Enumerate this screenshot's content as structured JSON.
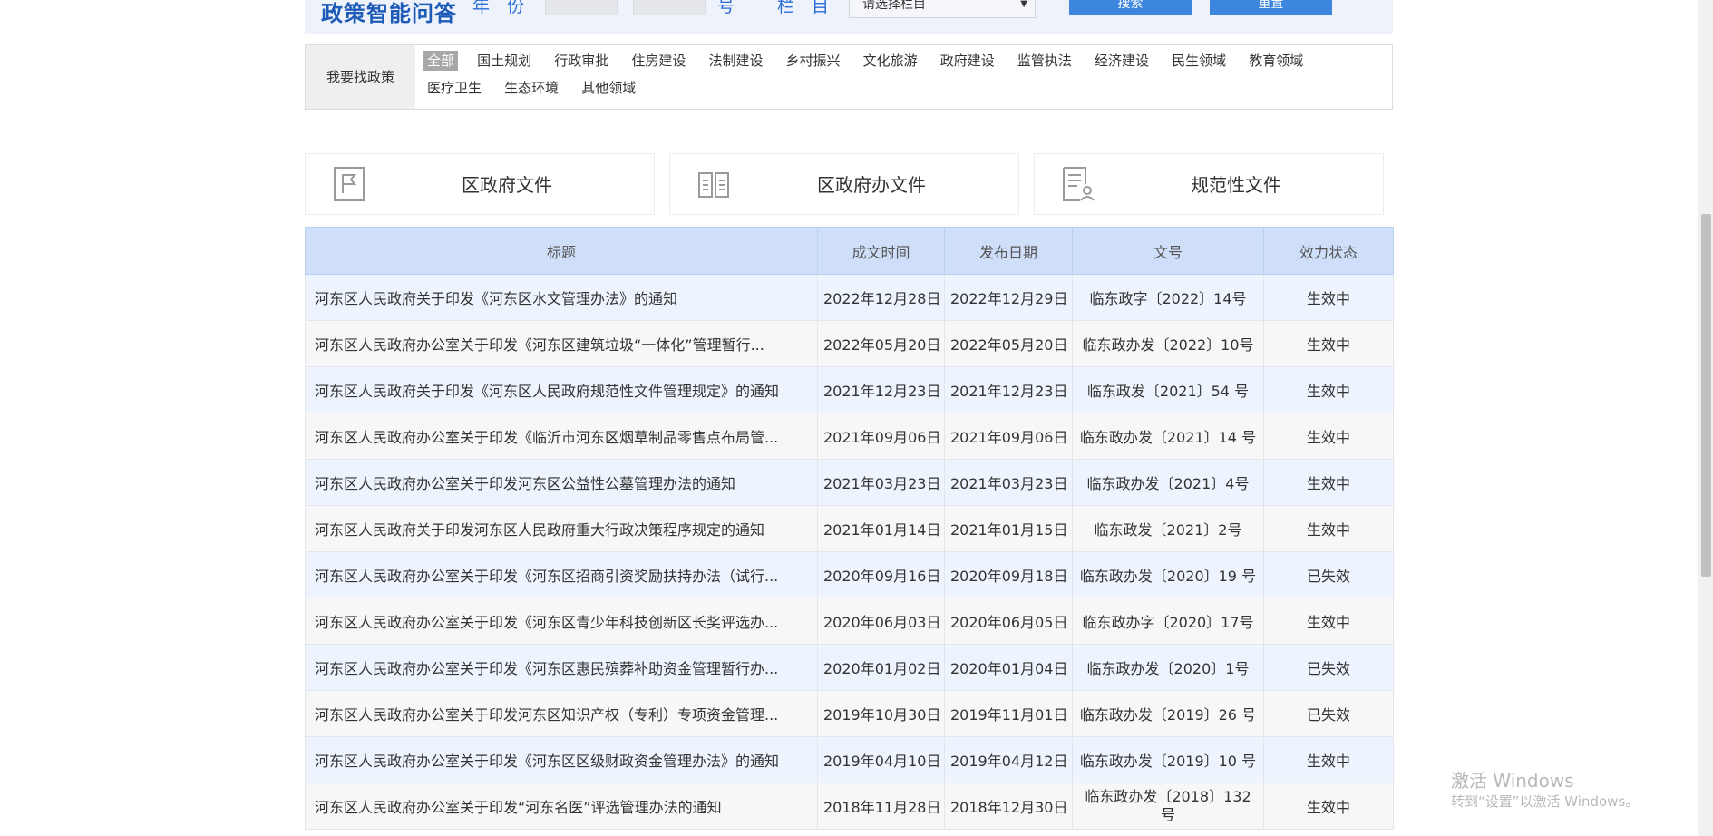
{
  "search": {
    "logo": "政策智能问答",
    "year_label": "年　份",
    "number_label": "号",
    "column_label": "栏　目",
    "column_select": "请选择栏目",
    "search_button": "搜索",
    "reset_button": "重置"
  },
  "filter": {
    "label": "我要找政策",
    "categories": [
      "全部",
      "国土规划",
      "行政审批",
      "住房建设",
      "法制建设",
      "乡村振兴",
      "文化旅游",
      "政府建设",
      "监管执法",
      "经济建设",
      "民生领域",
      "教育领域",
      "医疗卫生",
      "生态环境",
      "其他领域"
    ]
  },
  "cards": [
    "区政府文件",
    "区政府办文件",
    "规范性文件"
  ],
  "table": {
    "headers": [
      "标题",
      "成文时间",
      "发布日期",
      "文号",
      "效力状态"
    ],
    "rows": [
      [
        "河东区人民政府关于印发《河东区水文管理办法》的通知",
        "2022年12月28日",
        "2022年12月29日",
        "临东政字〔2022〕14号",
        "生效中"
      ],
      [
        "河东区人民政府办公室关于印发《河东区建筑垃圾“一体化”管理暂行...",
        "2022年05月20日",
        "2022年05月20日",
        "临东政办发〔2022〕10号",
        "生效中"
      ],
      [
        "河东区人民政府关于印发《河东区人民政府规范性文件管理规定》的通知",
        "2021年12月23日",
        "2021年12月23日",
        "临东政发〔2021〕54 号",
        "生效中"
      ],
      [
        "河东区人民政府办公室关于印发《临沂市河东区烟草制品零售点布局管...",
        "2021年09月06日",
        "2021年09月06日",
        "临东政办发〔2021〕14 号",
        "生效中"
      ],
      [
        "河东区人民政府办公室关于印发河东区公益性公墓管理办法的通知",
        "2021年03月23日",
        "2021年03月23日",
        "临东政办发〔2021〕4号",
        "生效中"
      ],
      [
        "河东区人民政府关于印发河东区人民政府重大行政决策程序规定的通知",
        "2021年01月14日",
        "2021年01月15日",
        "临东政发〔2021〕2号",
        "生效中"
      ],
      [
        "河东区人民政府办公室关于印发《河东区招商引资奖励扶持办法（试行...",
        "2020年09月16日",
        "2020年09月18日",
        "临东政办发〔2020〕19 号",
        "已失效"
      ],
      [
        "河东区人民政府办公室关于印发《河东区青少年科技创新区长奖评选办...",
        "2020年06月03日",
        "2020年06月05日",
        "临东政办字〔2020〕17号",
        "生效中"
      ],
      [
        "河东区人民政府办公室关于印发《河东区惠民殡葬补助资金管理暂行办...",
        "2020年01月02日",
        "2020年01月04日",
        "临东政办发〔2020〕1号",
        "已失效"
      ],
      [
        "河东区人民政府办公室关于印发河东区知识产权（专利）专项资金管理...",
        "2019年10月30日",
        "2019年11月01日",
        "临东政办发〔2019〕26 号",
        "已失效"
      ],
      [
        "河东区人民政府办公室关于印发《河东区区级财政资金管理办法》的通知",
        "2019年04月10日",
        "2019年04月12日",
        "临东政办发〔2019〕10 号",
        "生效中"
      ],
      [
        "河东区人民政府办公室关于印发“河东名医”评选管理办法的通知",
        "2018年11月28日",
        "2018年12月30日",
        "临东政办发〔2018〕132号",
        "生效中"
      ]
    ]
  },
  "watermark": {
    "line1": "激活 Windows",
    "line2": "转到“设置”以激活 Windows。"
  }
}
